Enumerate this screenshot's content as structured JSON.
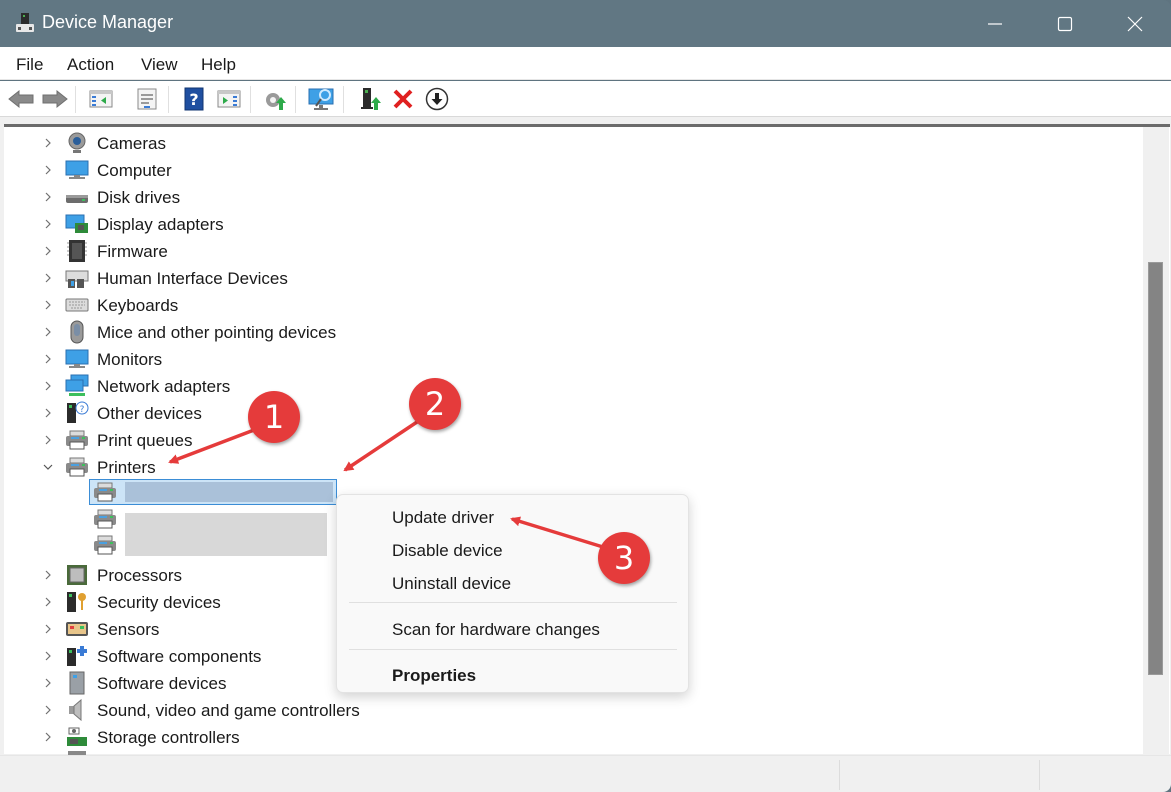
{
  "window": {
    "title": "Device Manager",
    "controls": {
      "minimize": "minimize",
      "maximize": "maximize",
      "close": "close"
    }
  },
  "menubar": {
    "items": [
      {
        "label": "File"
      },
      {
        "label": "Action"
      },
      {
        "label": "View"
      },
      {
        "label": "Help"
      }
    ]
  },
  "toolbar": {
    "buttons": [
      {
        "name": "back",
        "icon": "back-arrow-icon"
      },
      {
        "name": "forward",
        "icon": "forward-arrow-icon"
      },
      {
        "name": "show-hide-console-tree",
        "icon": "console-tree-icon"
      },
      {
        "name": "properties",
        "icon": "properties-icon"
      },
      {
        "name": "help",
        "icon": "help-icon"
      },
      {
        "name": "show-hide-action-pane",
        "icon": "action-pane-icon"
      },
      {
        "name": "update-driver",
        "icon": "update-driver-icon"
      },
      {
        "name": "scan-hardware",
        "icon": "scan-monitor-icon"
      },
      {
        "name": "enable-device",
        "icon": "enable-device-icon"
      },
      {
        "name": "uninstall-device",
        "icon": "uninstall-x-icon"
      },
      {
        "name": "disable-device",
        "icon": "disable-down-arrow-icon"
      }
    ]
  },
  "tree": {
    "categories": [
      {
        "label": "Cameras",
        "icon": "camera-icon",
        "expanded": false
      },
      {
        "label": "Computer",
        "icon": "computer-icon",
        "expanded": false
      },
      {
        "label": "Disk drives",
        "icon": "disk-drive-icon",
        "expanded": false
      },
      {
        "label": "Display adapters",
        "icon": "display-adapter-icon",
        "expanded": false
      },
      {
        "label": "Firmware",
        "icon": "firmware-chip-icon",
        "expanded": false
      },
      {
        "label": "Human Interface Devices",
        "icon": "hid-icon",
        "expanded": false
      },
      {
        "label": "Keyboards",
        "icon": "keyboard-icon",
        "expanded": false
      },
      {
        "label": "Mice and other pointing devices",
        "icon": "mouse-icon",
        "expanded": false
      },
      {
        "label": "Monitors",
        "icon": "monitor-icon",
        "expanded": false
      },
      {
        "label": "Network adapters",
        "icon": "network-adapter-icon",
        "expanded": false
      },
      {
        "label": "Other devices",
        "icon": "unknown-device-icon",
        "expanded": false
      },
      {
        "label": "Print queues",
        "icon": "printer-icon",
        "expanded": false
      },
      {
        "label": "Printers",
        "icon": "printer-icon",
        "expanded": true
      }
    ],
    "printer_children": [
      {
        "label": "",
        "redacted": true,
        "selected": true
      },
      {
        "label": "",
        "redacted": true,
        "selected": false
      },
      {
        "label": "",
        "redacted": true,
        "selected": false
      }
    ],
    "categories_after": [
      {
        "label": "Processors",
        "icon": "processor-icon",
        "expanded": false
      },
      {
        "label": "Security devices",
        "icon": "security-device-icon",
        "expanded": false
      },
      {
        "label": "Sensors",
        "icon": "sensor-icon",
        "expanded": false
      },
      {
        "label": "Software components",
        "icon": "software-component-icon",
        "expanded": false
      },
      {
        "label": "Software devices",
        "icon": "software-device-icon",
        "expanded": false
      },
      {
        "label": "Sound, video and game controllers",
        "icon": "speaker-icon",
        "expanded": false
      },
      {
        "label": "Storage controllers",
        "icon": "storage-controller-icon",
        "expanded": false
      }
    ]
  },
  "context_menu": {
    "items": [
      {
        "label": "Update driver",
        "bold": false
      },
      {
        "label": "Disable device",
        "bold": false
      },
      {
        "label": "Uninstall device",
        "bold": false
      },
      {
        "label": "Scan for hardware changes",
        "bold": false
      },
      {
        "label": "Properties",
        "bold": true
      }
    ]
  },
  "callouts": [
    {
      "number": "1",
      "target": "Printers"
    },
    {
      "number": "2",
      "target": "selected printer"
    },
    {
      "number": "3",
      "target": "Update driver"
    }
  ],
  "colors": {
    "titlebar": "#617783",
    "selection_border": "#3b8dd6",
    "selection_fill": "#cce4f7",
    "callout_red": "#e53b3b"
  }
}
